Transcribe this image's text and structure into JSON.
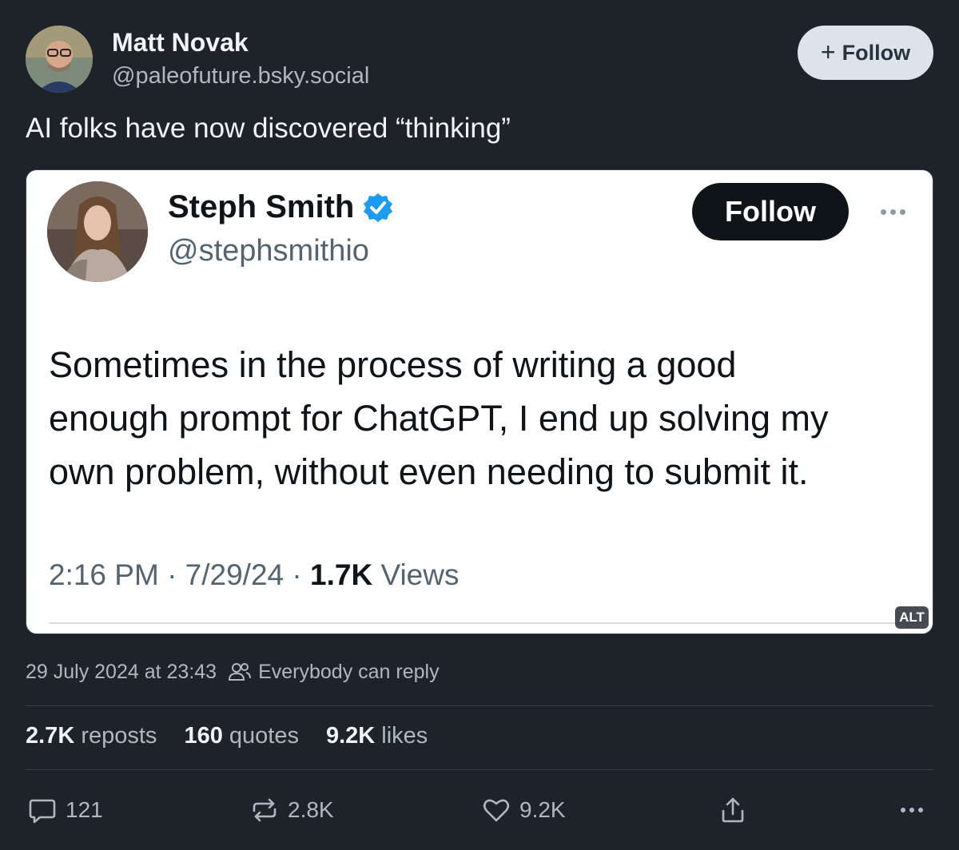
{
  "author": {
    "name": "Matt Novak",
    "handle": "@paleofuture.bsky.social"
  },
  "follow_button": {
    "icon": "+",
    "label": "Follow"
  },
  "post_text": "AI folks have now discovered “thinking”",
  "embed": {
    "tweet": {
      "name": "Steph Smith",
      "handle": "@stephsmithio",
      "follow_label": "Follow",
      "lines": [
        "Sometimes in the process of writing a good",
        "enough prompt for ChatGPT, I end up solving my",
        "own problem, without even needing to submit it."
      ],
      "meta_time": "2:16 PM · 7/29/24 · ",
      "meta_views_count": "1.7K",
      "meta_views_label": " Views"
    },
    "alt_badge": "ALT"
  },
  "timestamp": "29 July 2024 at 23:43",
  "reply_setting": "Everybody can reply",
  "stats": {
    "reposts_count": "2.7K",
    "reposts_label": "reposts",
    "quotes_count": "160",
    "quotes_label": "quotes",
    "likes_count": "9.2K",
    "likes_label": "likes"
  },
  "actions": {
    "reply_count": "121",
    "repost_count": "2.8K",
    "like_count": "9.2K"
  },
  "colors": {
    "background": "#1e2229",
    "text_primary": "#f1f3f5",
    "text_secondary": "#aeb8c4",
    "follow_button_bg": "#dde3ea",
    "tweet_verified": "#1d9bf0"
  },
  "icons": [
    "plus-icon",
    "verified-badge-icon",
    "more-dots-icon",
    "people-icon",
    "reply-icon",
    "repost-icon",
    "like-icon",
    "share-icon",
    "more-options-icon"
  ]
}
